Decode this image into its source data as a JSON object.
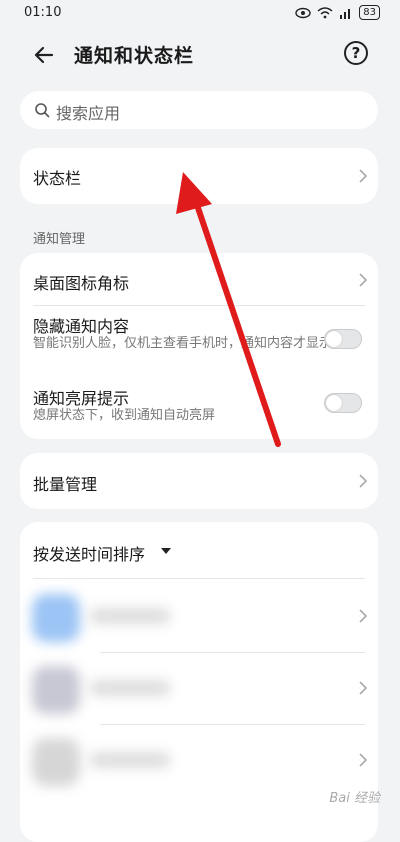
{
  "status_bar": {
    "time": "01:10",
    "battery": "83"
  },
  "header": {
    "title": "通知和状态栏",
    "help_label": "?"
  },
  "search": {
    "placeholder": "搜索应用"
  },
  "status_bar_item": {
    "label": "状态栏"
  },
  "notification_section": {
    "label": "通知管理",
    "items": [
      {
        "title": "桌面图标角标"
      },
      {
        "title": "隐藏通知内容",
        "subtitle": "智能识别人脸，仅机主查看手机时，通知内容才显示",
        "toggle": "off"
      },
      {
        "title": "通知亮屏提示",
        "subtitle": "熄屏状态下，收到通知自动亮屏",
        "toggle": "off"
      }
    ]
  },
  "batch": {
    "label": "批量管理"
  },
  "app_list": {
    "sort_label": "按发送时间排序"
  },
  "watermark": {
    "text": "Bai 经验"
  },
  "colors": {
    "arrow": "#e01b1b",
    "background": "#f1f3f5"
  }
}
